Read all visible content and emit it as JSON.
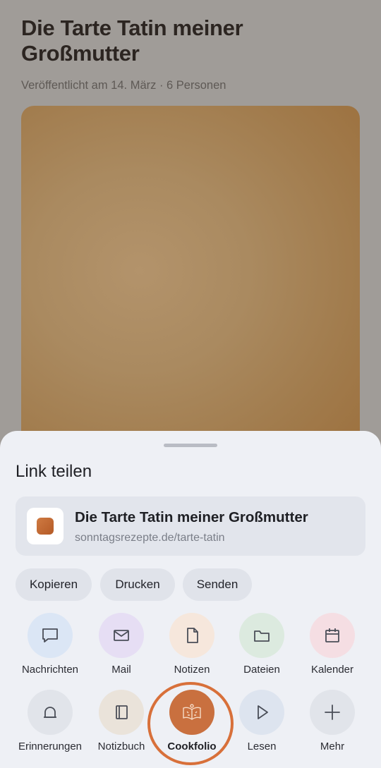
{
  "article": {
    "title": "Die Tarte Tatin meiner Großmutter",
    "meta": "Veröffentlicht am 14. März · 6 Personen"
  },
  "share_sheet": {
    "title": "Link teilen",
    "link": {
      "title": "Die Tarte Tatin meiner Großmutter",
      "url": "sonntagsrezepte.de/tarte-tatin"
    },
    "actions": [
      "Kopieren",
      "Drucken",
      "Senden"
    ],
    "apps_row1": [
      {
        "label": "Nachrichten",
        "icon": "chat-bubble-icon",
        "color": "#dbe6f5"
      },
      {
        "label": "Mail",
        "icon": "mail-icon",
        "color": "#e6def4"
      },
      {
        "label": "Notizen",
        "icon": "document-icon",
        "color": "#f6e7dc"
      },
      {
        "label": "Dateien",
        "icon": "folder-icon",
        "color": "#dceadf"
      },
      {
        "label": "Kalender",
        "icon": "calendar-icon",
        "color": "#f5dee3"
      }
    ],
    "apps_row2": [
      {
        "label": "Erinnerungen",
        "icon": "bell-icon",
        "color": "#e1e4ea"
      },
      {
        "label": "Notizbuch",
        "icon": "notebook-icon",
        "color": "#eae3da"
      },
      {
        "label": "Cookfolio",
        "icon": "cookbook-icon",
        "color": "#c9703f"
      },
      {
        "label": "Lesen",
        "icon": "play-icon",
        "color": "#dde4ef"
      },
      {
        "label": "Mehr",
        "icon": "plus-icon",
        "color": "#e1e4ea"
      }
    ],
    "highlight_color": "#d8703a"
  }
}
